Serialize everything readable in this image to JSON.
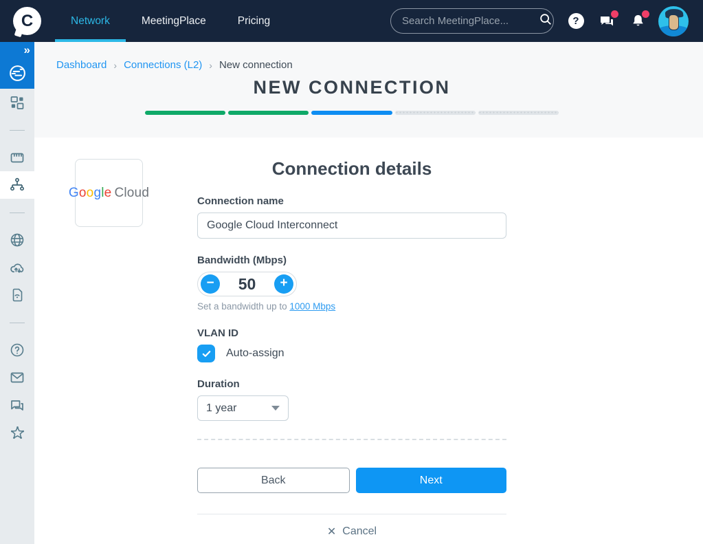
{
  "navbar": {
    "logo_letter": "C",
    "links": [
      {
        "label": "Network",
        "active": true
      },
      {
        "label": "MeetingPlace",
        "active": false
      },
      {
        "label": "Pricing",
        "active": false
      }
    ],
    "search": {
      "placeholder": "Search MeetingPlace..."
    },
    "icons": [
      "help-icon",
      "messages-icon",
      "notifications-icon"
    ],
    "badges": {
      "messages_unread": true,
      "notifications_unread": true
    }
  },
  "sidebar": {
    "expand_glyph": "»",
    "items": [
      "dashboard",
      "ports",
      "connections-active",
      "internet",
      "cloud-transfer",
      "device-wifi",
      "help",
      "mail",
      "chat",
      "referral"
    ]
  },
  "breadcrumb": {
    "items": [
      {
        "label": "Dashboard",
        "link": true
      },
      {
        "label": "Connections (L2)",
        "link": true
      },
      {
        "label": "New connection",
        "link": false
      }
    ],
    "separator": "›"
  },
  "page": {
    "title": "NEW CONNECTION",
    "progress": {
      "segments": [
        "complete",
        "complete",
        "current",
        "upcoming",
        "upcoming"
      ]
    }
  },
  "provider": {
    "letters": [
      "G",
      "o",
      "o",
      "g",
      "l",
      "e"
    ],
    "suffix": "Cloud"
  },
  "form": {
    "heading": "Connection details",
    "connection_name": {
      "label": "Connection name",
      "value": "Google Cloud Interconnect"
    },
    "bandwidth": {
      "label": "Bandwidth (Mbps)",
      "value": "50",
      "minus": "−",
      "plus": "+",
      "helper_prefix": "Set a bandwidth up to",
      "helper_link": "1000 Mbps"
    },
    "vlan": {
      "label": "VLAN ID",
      "checkbox_label": "Auto-assign",
      "checked": true
    },
    "duration": {
      "label": "Duration",
      "value": "1 year"
    },
    "buttons": {
      "back": "Back",
      "next": "Next",
      "cancel": "Cancel",
      "cancel_x": "✕"
    }
  },
  "colors": {
    "navbar_bg": "#16253c",
    "accent_cyan": "#2cb8e6",
    "link_blue": "#2095f2",
    "action_blue": "#189ef3",
    "progress_green": "#0fa968",
    "progress_blue": "#0e8df2",
    "badge_pink": "#ef3e68",
    "sidebar_bg": "#e7ebee",
    "sidebar_active_block": "#0d79d4",
    "google_letter_colors": [
      "#4285F4",
      "#EA4335",
      "#FBBC05",
      "#4285F4",
      "#34A853",
      "#EA4335"
    ]
  }
}
